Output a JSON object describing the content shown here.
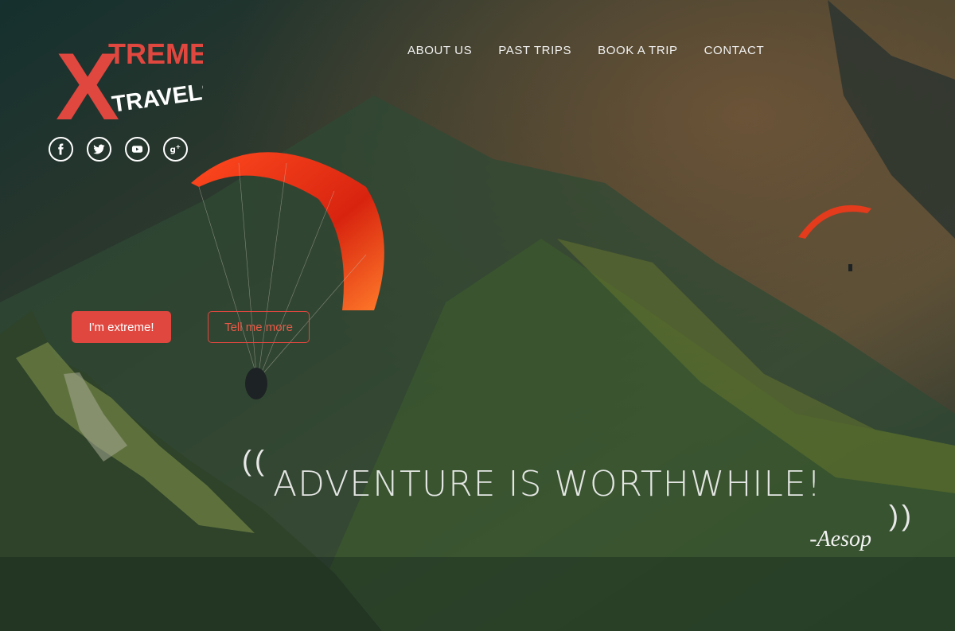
{
  "brand": {
    "logo_letter": "X",
    "logo_line1": "TREME",
    "logo_line2": "TRAVELS",
    "accent_color": "#e0473f"
  },
  "social": [
    {
      "name": "facebook",
      "glyph": "f"
    },
    {
      "name": "twitter",
      "glyph": ""
    },
    {
      "name": "youtube",
      "glyph": ""
    },
    {
      "name": "google-plus",
      "glyph": "g+"
    }
  ],
  "nav": {
    "items": [
      "ABOUT US",
      "PAST TRIPS",
      "BOOK A TRIP",
      "CONTACT"
    ]
  },
  "cta": {
    "primary_label": "I'm extreme!",
    "secondary_label": "Tell me more"
  },
  "quote": {
    "open_mark": "((",
    "text": "ADVENTURE IS WORTHWHILE!",
    "close_mark": "))",
    "author": "-Aesop"
  }
}
